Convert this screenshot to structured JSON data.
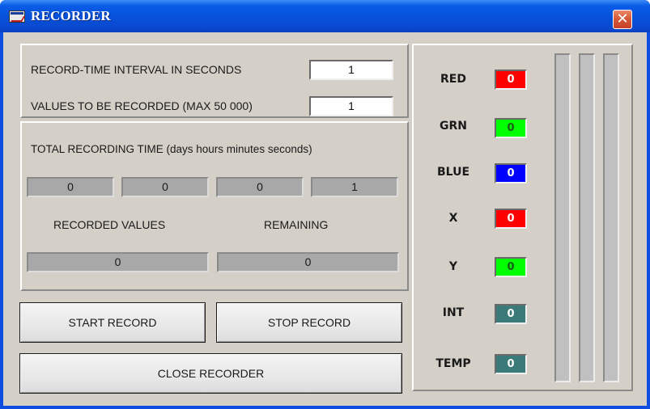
{
  "window": {
    "title": "RECORDER",
    "close_icon": "close-x-icon"
  },
  "settings": {
    "interval_label": "RECORD-TIME INTERVAL IN SECONDS",
    "interval_value": "1",
    "count_label": "VALUES TO BE RECORDED (MAX 50 000)",
    "count_value": "1"
  },
  "recording_time": {
    "label": "TOTAL RECORDING TIME (days  hours  minutes seconds)",
    "days": "0",
    "hours": "0",
    "minutes": "0",
    "seconds": "1"
  },
  "progress": {
    "recorded_label": "RECORDED VALUES",
    "recorded_value": "0",
    "remaining_label": "REMAINING",
    "remaining_value": "0"
  },
  "buttons": {
    "start": "START RECORD",
    "stop": "STOP RECORD",
    "close": "CLOSE RECORDER"
  },
  "channels": [
    {
      "label": "RED",
      "value": "0",
      "color": "#ff0000"
    },
    {
      "label": "GRN",
      "value": "0",
      "color": "#00ff00"
    },
    {
      "label": "BLUE",
      "value": "0",
      "color": "#0000ff"
    },
    {
      "label": "X",
      "value": "0",
      "color": "#ff0000"
    },
    {
      "label": "Y",
      "value": "0",
      "color": "#00ff00"
    },
    {
      "label": "INT",
      "value": "0",
      "color": "#3a7a78"
    },
    {
      "label": "TEMP",
      "value": "0",
      "color": "#3a7a78"
    }
  ],
  "level_bars": [
    {
      "fill_fraction": 0
    },
    {
      "fill_fraction": 0
    },
    {
      "fill_fraction": 0
    }
  ],
  "colors": {
    "titlebar": "#0a5ce8",
    "face": "#d4d0c8",
    "indicator": "#a8a8a8"
  }
}
